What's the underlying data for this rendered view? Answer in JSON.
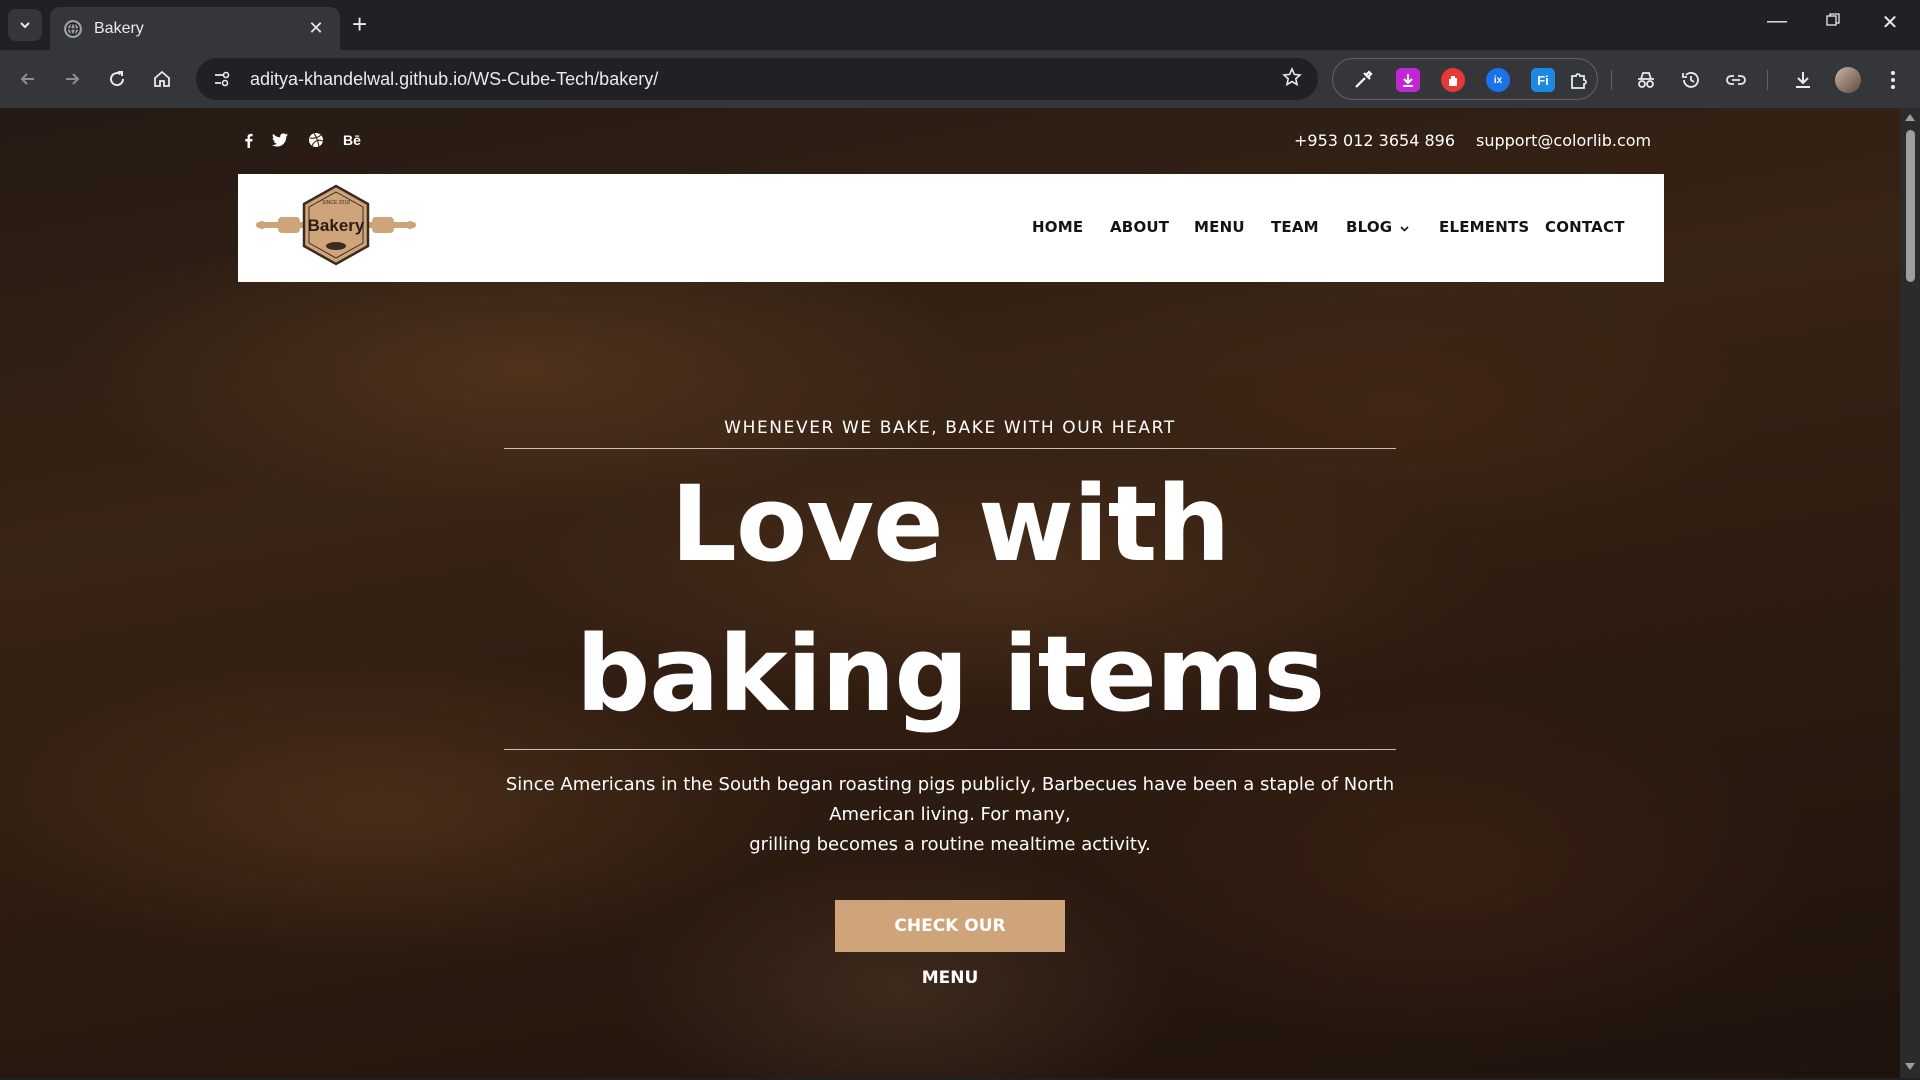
{
  "browser": {
    "tab_title": "Bakery",
    "url": "aditya-khandelwal.github.io/WS-Cube-Tech/bakery/",
    "extensions": [
      {
        "name": "eyedropper-extension",
        "color": "#3c4043",
        "glyph": "✎"
      },
      {
        "name": "downloader-extension",
        "color": "#c026d3",
        "glyph": "↓"
      },
      {
        "name": "adblock-extension",
        "color": "#e53935",
        "glyph": "✋"
      },
      {
        "name": "ixigo-extension",
        "color": "#1a73e8",
        "glyph": "ix"
      },
      {
        "name": "fi-extension",
        "color": "#1e88e5",
        "glyph": "Fi"
      }
    ]
  },
  "topbar": {
    "social": [
      "f",
      "t",
      "d",
      "Bē"
    ],
    "phone": "+953 012 3654 896",
    "email": "support@colorlib.com"
  },
  "logo": {
    "text": "Bakery",
    "since": "SINCE 2018"
  },
  "nav": {
    "home": "HOME",
    "about": "ABOUT",
    "menu": "MENU",
    "team": "TEAM",
    "blog": "BLOG",
    "elements": "ELEMENTS",
    "contact": "CONTACT"
  },
  "hero": {
    "eyebrow": "WHENEVER WE BAKE, BAKE WITH OUR HEART",
    "headline": "Love with baking items",
    "description_lines": [
      "Since Americans in the South began roasting pigs publicly, Barbecues have been a staple of North",
      "American living. For many,",
      "grilling becomes a routine mealtime activity."
    ],
    "cta": "CHECK OUR MENU"
  },
  "colors": {
    "accent": "#d0a47a",
    "nav_text": "#141414",
    "chrome_dark": "#202124",
    "chrome_toolbar": "#35363a"
  }
}
